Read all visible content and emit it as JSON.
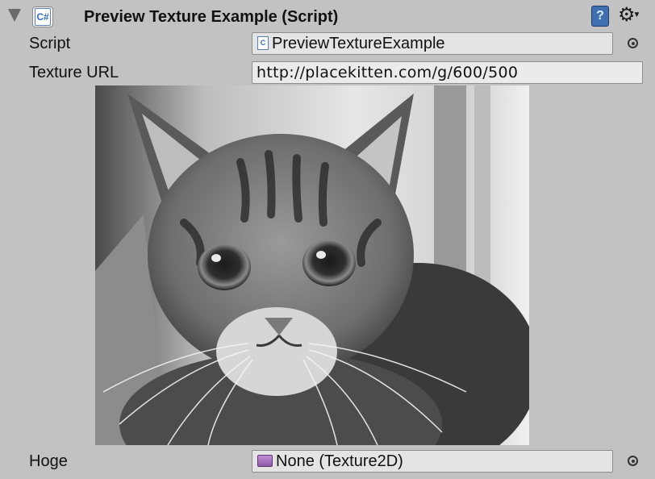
{
  "component": {
    "title": "Preview Texture Example (Script)",
    "enabled": true,
    "icon": "csharp-script-icon",
    "help_icon": "help-book-icon",
    "menu_icon": "gear-icon"
  },
  "properties": {
    "script": {
      "label": "Script",
      "value": "PreviewTextureExample",
      "icon": "csharp-script-icon"
    },
    "texture_url": {
      "label": "Texture URL",
      "value": "http://placekitten.com/g/600/500"
    },
    "hoge": {
      "label": "Hoge",
      "value": "None (Texture2D)",
      "icon": "texture2d-icon"
    }
  },
  "preview": {
    "subject": "grayscale-kitten-photo"
  },
  "colors": {
    "inspector_bg": "#c2c2c2",
    "field_bg": "#e4e4e4",
    "field_border": "#8e8e8e",
    "help_icon": "#3f6fb0"
  }
}
